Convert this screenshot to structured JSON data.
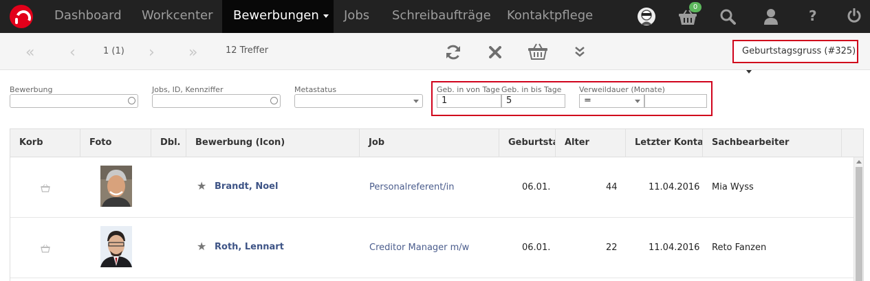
{
  "nav": {
    "items": [
      "Dashboard",
      "Workcenter",
      "Bewerbungen",
      "Jobs",
      "Schreibaufträge",
      "Kontaktpflege"
    ],
    "basket_count": "0",
    "colors": {
      "bar": "#222222",
      "active": "#080808",
      "badge": "#5cb85c",
      "brand": "#e2001a"
    }
  },
  "toolbar": {
    "page": "1 (1)",
    "hits": "12 Treffer",
    "view_select": "Geburtstagsgruss (#325)",
    "icons": [
      "first-page-icon",
      "prev-page-icon",
      "next-page-icon",
      "last-page-icon",
      "refresh-icon",
      "clear-icon",
      "basket-icon",
      "expand-icon"
    ]
  },
  "filters": {
    "bewerbung_label": "Bewerbung",
    "jobs_label": "Jobs, ID, Kennziffer",
    "metastatus_label": "Metastatus",
    "geb_von_label": "Geb. in von Tage",
    "geb_von_value": "1",
    "geb_bis_label": "Geb. in bis Tage",
    "geb_bis_value": "5",
    "verweildauer_label": "Verweildauer (Monate)",
    "verweildauer_op": "="
  },
  "table": {
    "headers": [
      "Korb",
      "Foto",
      "Dbl.",
      "Bewerbung (Icon)",
      "Job",
      "Geburtstag",
      "Alter",
      "Letzter Kontakt",
      "Sachbearbeiter"
    ],
    "rows": [
      {
        "name": "Brandt, Noel",
        "job": "Personalreferent/in",
        "geburtstag": "06.01.",
        "alter": "44",
        "kontakt": "11.04.2016",
        "sachbearbeiter": "Mia Wyss"
      },
      {
        "name": "Roth, Lennart",
        "job": "Creditor Manager m/w",
        "geburtstag": "06.01.",
        "alter": "22",
        "kontakt": "11.04.2016",
        "sachbearbeiter": "Reto Fanzen"
      }
    ]
  }
}
